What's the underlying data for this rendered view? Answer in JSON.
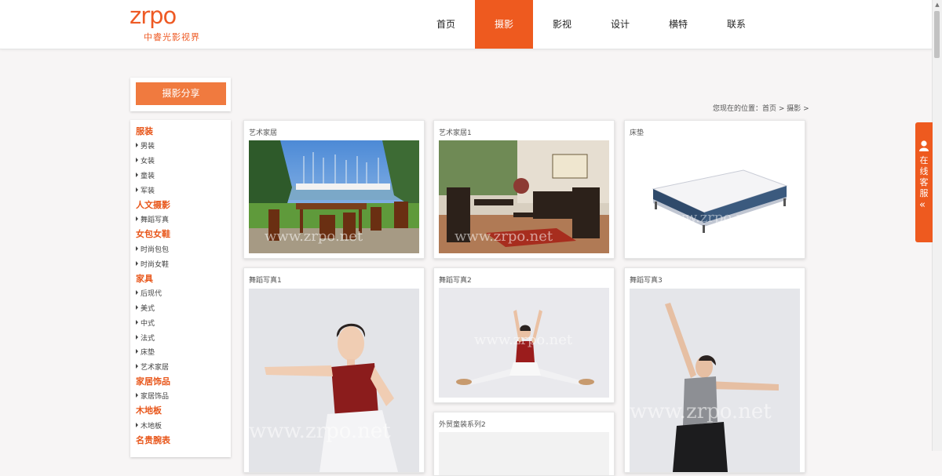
{
  "brand": {
    "logo_text": "zrpo",
    "logo_sub": "中睿光影视界"
  },
  "nav": [
    "首页",
    "摄影",
    "影视",
    "设计",
    "横特",
    "联系"
  ],
  "nav_active": "摄影",
  "sidebar": {
    "title": "摄影分享",
    "categories": [
      {
        "name": "服装",
        "items": [
          "男装",
          "女装",
          "童装",
          "军装"
        ]
      },
      {
        "name": "人文摄影",
        "items": [
          "舞蹈写真"
        ]
      },
      {
        "name": "女包女鞋",
        "items": [
          "时尚包包",
          "时尚女鞋"
        ]
      },
      {
        "name": "家具",
        "items": [
          "后现代",
          "美式",
          "中式",
          "法式",
          "床垫",
          "艺术家居"
        ]
      },
      {
        "name": "家居饰品",
        "items": [
          "家居饰品"
        ]
      },
      {
        "name": "木地板",
        "items": [
          "木地板"
        ]
      },
      {
        "name": "名贵腕表",
        "items": []
      }
    ]
  },
  "breadcrumb": "您现在的位置：首页 > 摄影 >",
  "cards": [
    {
      "title": "艺术家居",
      "scene": "outdoor-patio"
    },
    {
      "title": "艺术家居1",
      "scene": "living-room"
    },
    {
      "title": "床垫",
      "scene": "mattress"
    },
    {
      "title": "舞蹈写真1",
      "scene": "dancer-1"
    },
    {
      "title": "舞蹈写真2",
      "scene": "dancer-2"
    },
    {
      "title": "舞蹈写真3",
      "scene": "dancer-3"
    },
    {
      "title": "外贸童装系列2",
      "scene": "kids-clothes"
    }
  ],
  "watermark": "www.zrpo.net",
  "online_service": {
    "label": "在线客服",
    "collapse_icon": "double-chevron-left-icon"
  },
  "colors": {
    "accent": "#ee5a1f",
    "category": "#e8561a",
    "button": "#f07a3f"
  }
}
